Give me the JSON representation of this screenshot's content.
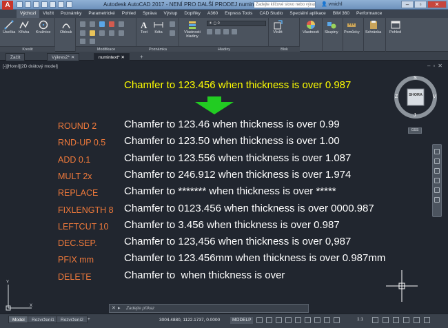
{
  "titlebar": {
    "title": "Autodesk AutoCAD 2017 - NENÍ PRO DALŠÍ PRODEJ    numintext.dwg",
    "search_placeholder": "Zadejte klíčové slovo nebo výraz",
    "user": "vmichl",
    "app_logo": "A"
  },
  "ribbon": {
    "tabs": [
      "Výchozí",
      "Vložit",
      "Poznámky",
      "Parametrické",
      "Pohled",
      "Správa",
      "Výstup",
      "Doplňky",
      "A360",
      "Express Tools",
      "CAD Studio",
      "Speciální aplikace",
      "BIM 360",
      "Performance"
    ],
    "active_tab": 0,
    "buttons": {
      "line": "Úsečka",
      "polyline": "Křivka",
      "circle": "Kružnice",
      "arc": "Oblouk",
      "text": "Text",
      "dimension": "Kóta",
      "layer_props": "Vlastnosti hladiny",
      "insert": "Vložit",
      "properties": "Vlastnosti",
      "groups": "Skupiny",
      "utilities": "Pomůcky",
      "clipboard": "Schránka",
      "view": "Pohled"
    },
    "panels": {
      "draw": "Kreslit",
      "modify": "Modifikace",
      "annotation": "Poznámka",
      "layers": "Hladiny",
      "block": "Blok"
    },
    "layer_combo": "0"
  },
  "filetabs": {
    "tabs": [
      "Začít",
      "Výkres2*",
      "numintext*"
    ],
    "active": 2,
    "add": "+"
  },
  "viewport": {
    "label": "[-][Horní][2D drátový model]",
    "controls": [
      "–",
      "▫",
      "✕"
    ],
    "header_text": "Chamfer to 123.456 when thickness is over 0.987",
    "rows": [
      {
        "op": "ROUND 2",
        "text": "Chamfer to 123.46 when thickness is over 0.99"
      },
      {
        "op": "RND-UP 0.5",
        "text": "Chamfer to 123.50 when thickness is over 1.00"
      },
      {
        "op": "ADD 0.1",
        "text": "Chamfer to 123.556 when thickness is over 1.087"
      },
      {
        "op": "MULT 2x",
        "text": "Chamfer to 246.912 when thickness is over 1.974"
      },
      {
        "op": "REPLACE",
        "text": "Chamfer to ******* when thickness is over *****"
      },
      {
        "op": "FIXLENGTH 8",
        "text": "Chamfer to 0123.456 when thickness is over 0000.987"
      },
      {
        "op": "LEFTCUT 10",
        "text": "Chamfer to 3.456 when thickness is over 0.987"
      },
      {
        "op": "DEC.SEP.",
        "text": "Chamfer to 123,456 when thickness is over 0,987"
      },
      {
        "op": "PFIX mm",
        "text": "Chamfer to 123.456mm when thickness is over 0.987mm"
      },
      {
        "op": "DELETE",
        "text": "Chamfer to  when thickness is over"
      }
    ],
    "viewcube": {
      "face": "SHORA",
      "north": "S",
      "south": "J",
      "east": "V",
      "west": "Z",
      "ucs": "GSS"
    },
    "ucs_labels": {
      "x": "X",
      "y": "Y"
    }
  },
  "cmdline": {
    "close": "✕",
    "prompt": "Zadejte příkaz"
  },
  "statusbar": {
    "layout_tabs": [
      "Model",
      "Rozvržení1",
      "Rozvržení2"
    ],
    "active_layout": 0,
    "add": "+",
    "coords": "3004.4880, 1122.1737, 0.0000",
    "space": "MODELP",
    "scale": "1:1"
  },
  "colors": {
    "canvas": "#21262f",
    "header_text": "#ffff00",
    "op_text": "#f07a3b",
    "row_text": "#ffffff",
    "arrow": "#22cc22"
  }
}
